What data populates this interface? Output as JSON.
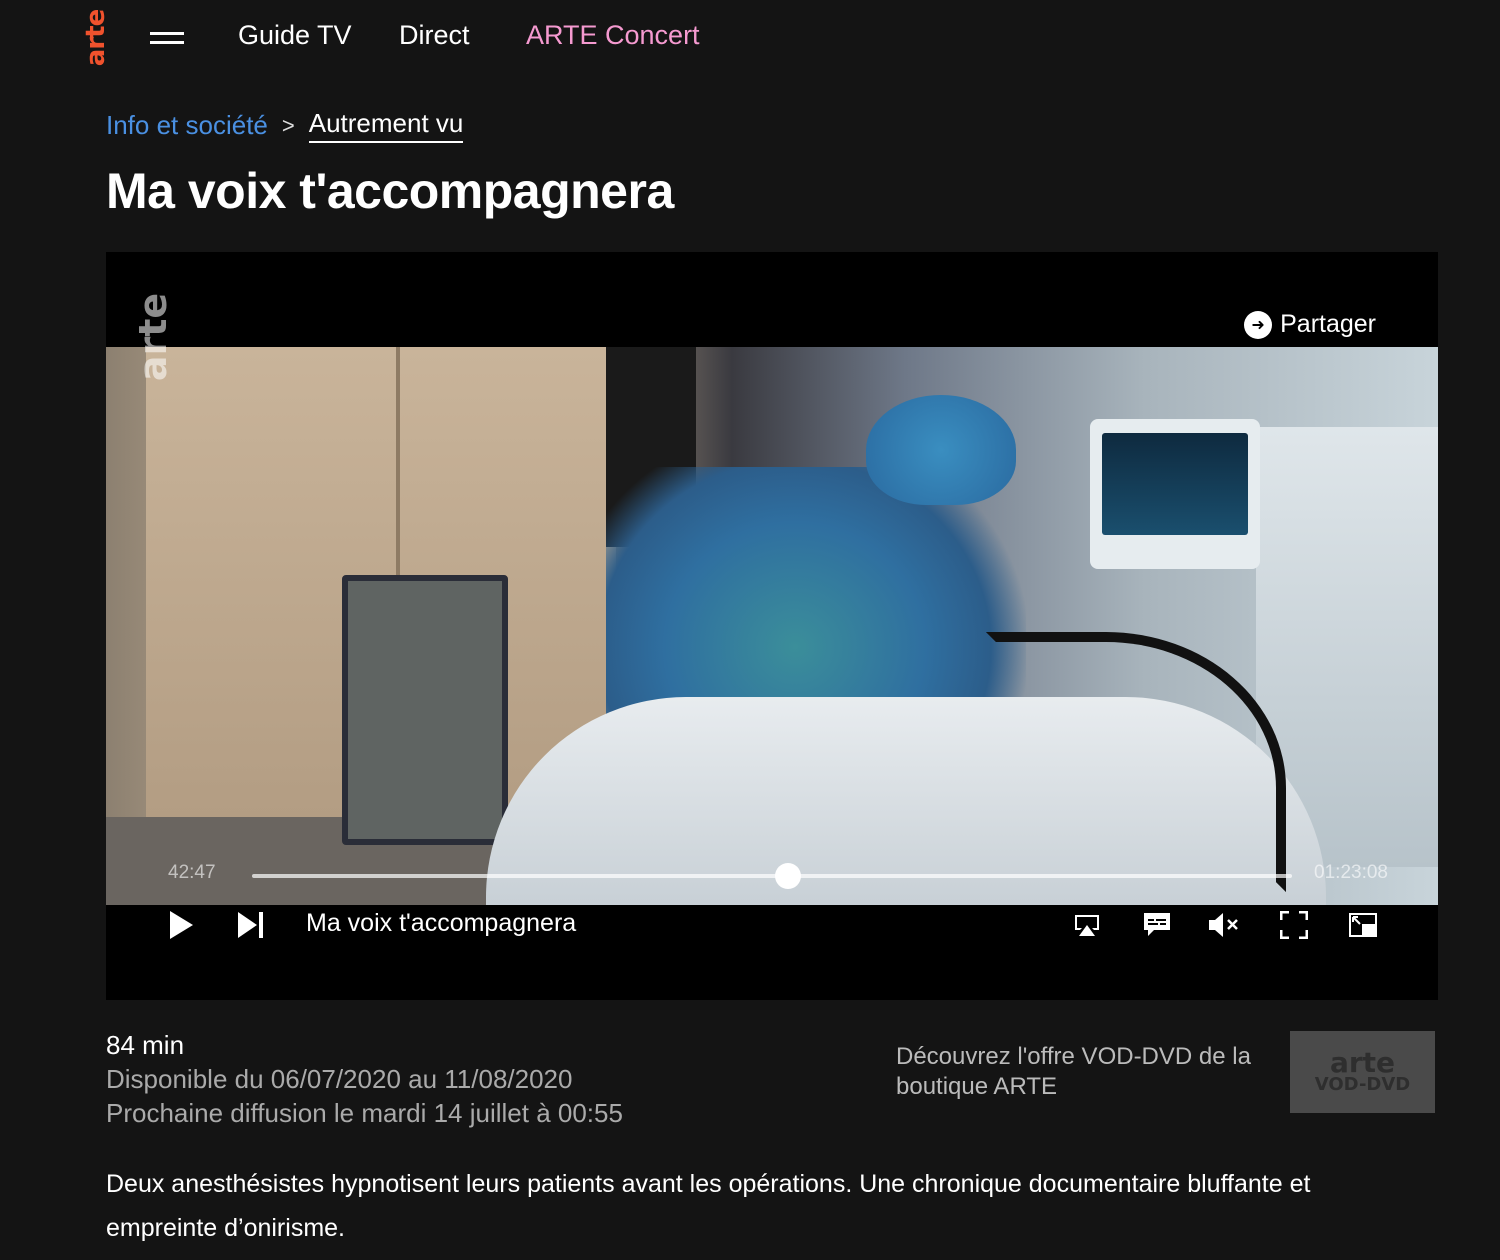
{
  "nav": {
    "logo": "arte",
    "items": [
      "Guide TV",
      "Direct",
      "ARTE Concert"
    ],
    "accent_color": "#f59ad0",
    "logo_color": "#f0522d"
  },
  "breadcrumb": {
    "category": "Info et société",
    "subcategory": "Autrement vu",
    "separator": ">"
  },
  "title": "Ma voix t'accompagnera",
  "player": {
    "watermark": "arte",
    "share_label": "Partager",
    "current_time": "42:47",
    "total_time": "01:23:08",
    "progress_fraction": 0.515,
    "title": "Ma voix t'accompagnera",
    "icons": [
      "play-icon",
      "next-icon",
      "airplay-icon",
      "subtitles-icon",
      "mute-icon",
      "fullscreen-icon",
      "pip-icon",
      "share-icon"
    ]
  },
  "info": {
    "duration": "84 min",
    "availability": "Disponible du 06/07/2020 au 11/08/2020",
    "next_broadcast": "Prochaine diffusion le mardi 14 juillet à 00:55",
    "vod_text": "Découvrez l'offre VOD-DVD de la boutique ARTE",
    "vod_logo_top": "arte",
    "vod_logo_bottom": "VOD-DVD",
    "description": "Deux anesthésistes hypnotisent leurs patients avant les opérations. Une chronique documentaire bluffante et empreinte d’onirisme."
  }
}
